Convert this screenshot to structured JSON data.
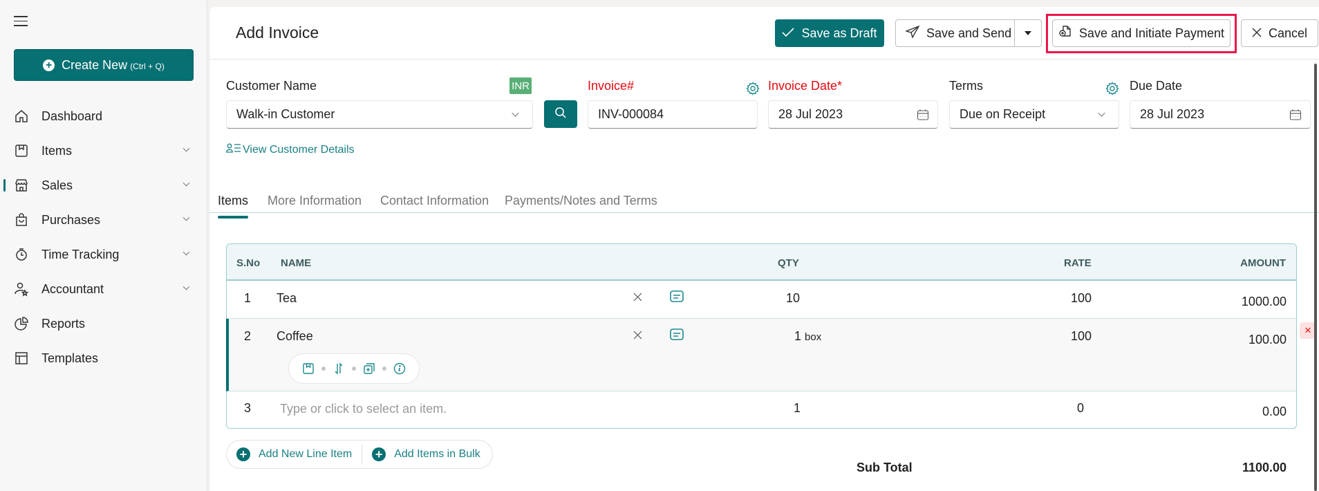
{
  "sidebar": {
    "create_new": {
      "label": "Create New",
      "shortcut": "(Ctrl + Q)"
    },
    "items": [
      {
        "label": "Dashboard",
        "icon": "home-icon",
        "has_chevron": false,
        "active": false
      },
      {
        "label": "Items",
        "icon": "item-box-icon",
        "has_chevron": true,
        "active": false
      },
      {
        "label": "Sales",
        "icon": "store-icon",
        "has_chevron": true,
        "active": true
      },
      {
        "label": "Purchases",
        "icon": "shopping-bag-icon",
        "has_chevron": true,
        "active": false
      },
      {
        "label": "Time Tracking",
        "icon": "stopwatch-icon",
        "has_chevron": true,
        "active": false
      },
      {
        "label": "Accountant",
        "icon": "person-star-icon",
        "has_chevron": true,
        "active": false
      },
      {
        "label": "Reports",
        "icon": "pie-chart-icon",
        "has_chevron": false,
        "active": false
      },
      {
        "label": "Templates",
        "icon": "layout-icon",
        "has_chevron": false,
        "active": false
      }
    ]
  },
  "header": {
    "title": "Add Invoice",
    "save_draft": "Save as Draft",
    "save_send": "Save and Send",
    "save_initiate_payment": "Save and Initiate Payment",
    "cancel": "Cancel"
  },
  "form": {
    "customer_name": {
      "label": "Customer Name",
      "value": "Walk-in Customer",
      "currency_badge": "INR"
    },
    "invoice_number": {
      "label": "Invoice#",
      "value": "INV-000084"
    },
    "invoice_date": {
      "label": "Invoice Date*",
      "value": "28 Jul 2023"
    },
    "terms": {
      "label": "Terms",
      "value": "Due on Receipt"
    },
    "due_date": {
      "label": "Due Date",
      "value": "28 Jul 2023"
    },
    "view_customer_details": "View Customer Details"
  },
  "tabs": [
    {
      "label": "Items",
      "active": true
    },
    {
      "label": "More Information",
      "active": false
    },
    {
      "label": "Contact Information",
      "active": false
    },
    {
      "label": "Payments/Notes and Terms",
      "active": false
    }
  ],
  "table": {
    "columns": [
      "S.No",
      "NAME",
      "QTY",
      "RATE",
      "AMOUNT"
    ],
    "rows": [
      {
        "sno": "1",
        "name": "Tea",
        "qty": "10",
        "unit": "",
        "rate": "100",
        "amount": "1000.00"
      },
      {
        "sno": "2",
        "name": "Coffee",
        "qty": "1",
        "unit": "box",
        "rate": "100",
        "amount": "100.00"
      },
      {
        "sno": "3",
        "name": "",
        "placeholder": "Type or click to select an item.",
        "qty": "1",
        "unit": "",
        "rate": "0",
        "amount": "0.00"
      }
    ]
  },
  "actions": {
    "add_line_item": "Add New Line Item",
    "add_items_bulk": "Add Items in Bulk"
  },
  "totals": {
    "sub_total_label": "Sub Total",
    "sub_total_value": "1100.00"
  },
  "colors": {
    "brand": "#077072",
    "required": "#e8080f",
    "highlight": "#e8174d",
    "badge": "#5aaf77"
  }
}
